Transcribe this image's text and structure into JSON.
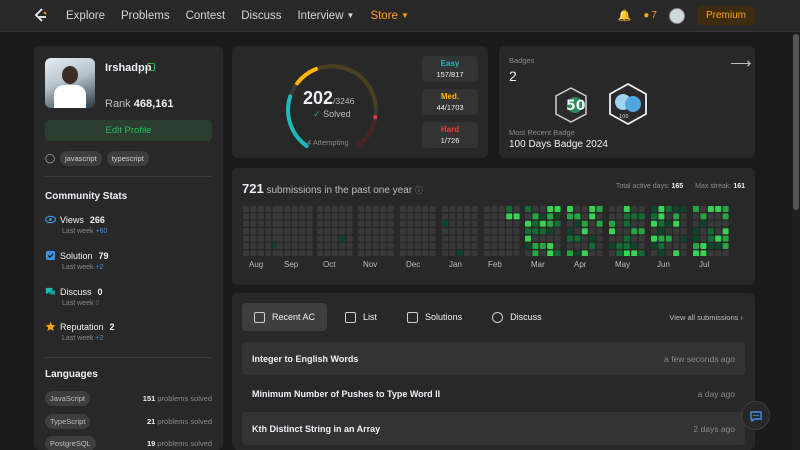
{
  "nav": {
    "items": [
      "Explore",
      "Problems",
      "Contest",
      "Discuss"
    ],
    "interview": "Interview",
    "store": "Store",
    "streak": "7",
    "premium": "Premium"
  },
  "profile": {
    "username": "Irshadpp",
    "rank_label": "Rank",
    "rank": "468,161",
    "edit": "Edit Profile",
    "tags": [
      "javascript",
      "typescript"
    ]
  },
  "community": {
    "title": "Community Stats",
    "stats": [
      {
        "label": "Views",
        "value": "266",
        "sub": "Last week",
        "delta": "+60"
      },
      {
        "label": "Solution",
        "value": "79",
        "sub": "Last week",
        "delta": "+2"
      },
      {
        "label": "Discuss",
        "value": "0",
        "sub": "Last week",
        "delta": "0"
      },
      {
        "label": "Reputation",
        "value": "2",
        "sub": "Last week",
        "delta": "+2"
      }
    ]
  },
  "languages": {
    "title": "Languages",
    "suffix": "problems solved",
    "items": [
      {
        "name": "JavaScript",
        "count": "151"
      },
      {
        "name": "TypeScript",
        "count": "21"
      },
      {
        "name": "PostgreSQL",
        "count": "19"
      }
    ]
  },
  "solved": {
    "count": "202",
    "total": "/3246",
    "label": "Solved",
    "attempting": "4 Attempting",
    "easy": {
      "label": "Easy",
      "value": "157/817",
      "color": "#1cbaba"
    },
    "medium": {
      "label": "Med.",
      "value": "44/1703",
      "color": "#ffb700"
    },
    "hard": {
      "label": "Hard",
      "value": "1/726",
      "color": "#f63737"
    }
  },
  "badges": {
    "label": "Badges",
    "count": "2",
    "recent_label": "Most Recent Badge",
    "recent_name": "100 Days Badge 2024",
    "badge1_text": "50",
    "badge2_text": "100"
  },
  "submissions": {
    "count": "721",
    "text": "submissions in the past one year",
    "active_label": "Total active days:",
    "active_value": "165",
    "streak_label": "Max streak:",
    "streak_value": "161",
    "months": [
      "Aug",
      "Sep",
      "Oct",
      "Nov",
      "Dec",
      "Jan",
      "Feb",
      "Mar",
      "Apr",
      "May",
      "Jun",
      "Jul"
    ]
  },
  "recent": {
    "tabs": [
      "Recent AC",
      "List",
      "Solutions",
      "Discuss"
    ],
    "view_all": "View all submissions",
    "rows": [
      {
        "title": "Integer to English Words",
        "time": "a few seconds ago"
      },
      {
        "title": "Minimum Number of Pushes to Type Word II",
        "time": "a day ago"
      },
      {
        "title": "Kth Distinct String in an Array",
        "time": "2 days ago"
      }
    ]
  },
  "colors": {
    "accent": "#ffa116",
    "green": "#2cbb5d",
    "heat_empty": "#393939",
    "heat_levels": [
      "#0e4429",
      "#116d35",
      "#26a641",
      "#39d353"
    ]
  }
}
